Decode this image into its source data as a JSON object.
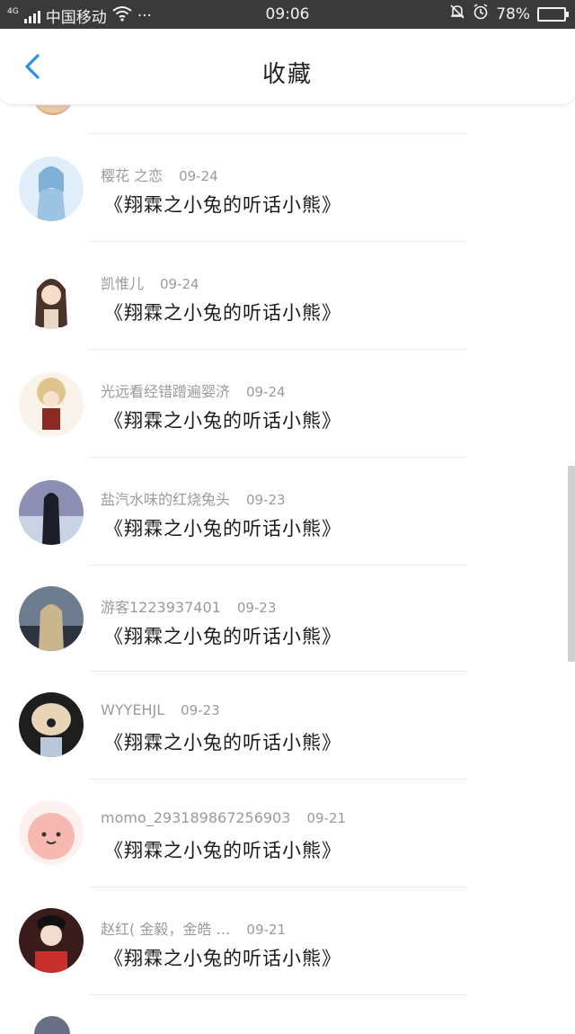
{
  "status_bar": {
    "network": "4G",
    "carrier": "中国移动",
    "more": "···",
    "time": "09:06",
    "battery": "78%",
    "battery_level": 0.78
  },
  "header": {
    "title": "收藏"
  },
  "items": [
    {
      "username": "樱花 之恋",
      "date": "09-24",
      "work": "《翔霖之小兔的听话小熊》"
    },
    {
      "username": "凯惟儿",
      "date": "09-24",
      "work": "《翔霖之小兔的听话小熊》"
    },
    {
      "username": "光远看经错蹭遍婴济",
      "date": "09-24",
      "work": "《翔霖之小兔的听话小熊》"
    },
    {
      "username": "盐汽水味的红烧兔头",
      "date": "09-23",
      "work": "《翔霖之小兔的听话小熊》"
    },
    {
      "username": "游客1223937401",
      "date": "09-23",
      "work": "《翔霖之小兔的听话小熊》"
    },
    {
      "username": "WYYEHJL",
      "date": "09-23",
      "work": "《翔霖之小兔的听话小熊》"
    },
    {
      "username": "momo_293189867256903",
      "date": "09-21",
      "work": "《翔霖之小兔的听话小熊》"
    },
    {
      "username": "赵红( 金毅，金皓 …",
      "date": "09-21",
      "work": "《翔霖之小兔的听话小熊》"
    }
  ]
}
